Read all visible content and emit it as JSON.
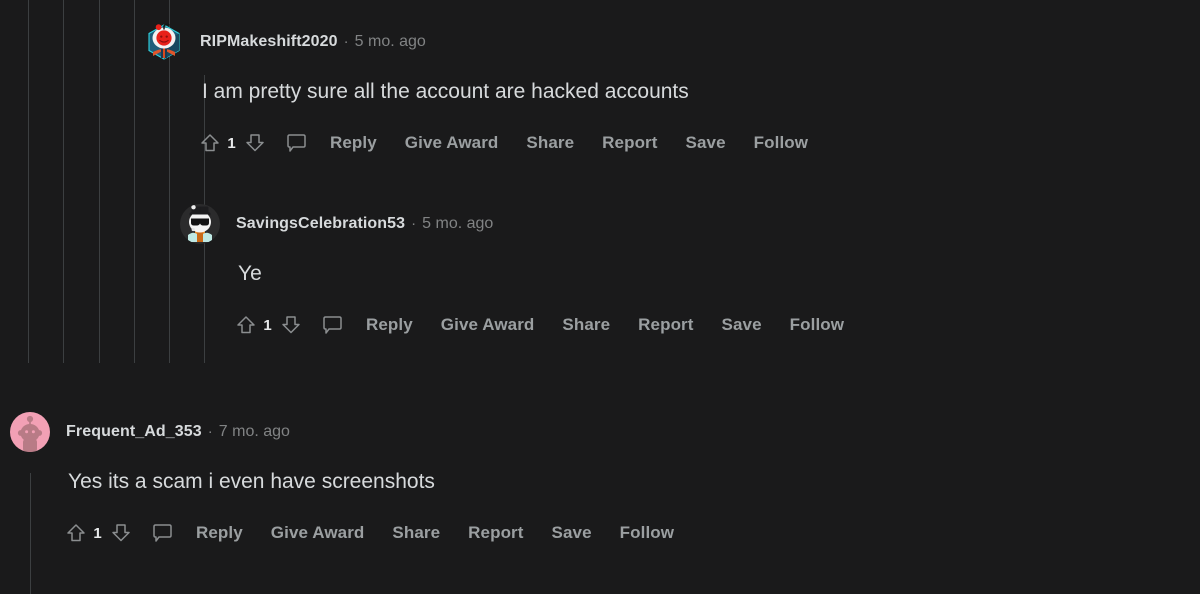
{
  "theme": {
    "background": "#1a1a1b",
    "text_primary": "#d7dadc",
    "text_muted": "#818384",
    "action_text": "#9b9fa1",
    "thread_line": "#3c3f41"
  },
  "actions": {
    "upvote_icon": "upvote-arrow-icon",
    "downvote_icon": "downvote-arrow-icon",
    "comment_icon": "comment-bubble-icon",
    "reply": "Reply",
    "give_award": "Give Award",
    "share": "Share",
    "report": "Report",
    "save": "Save",
    "follow": "Follow"
  },
  "separator": "·",
  "comments": [
    {
      "username": "RIPMakeshift2020",
      "timestamp": "5 mo. ago",
      "body": "I am pretty sure all the account are hacked accounts",
      "score": "1",
      "avatar": "snoo-red-hexagon-avatar"
    },
    {
      "username": "SavingsCelebration53",
      "timestamp": "5 mo. ago",
      "body": "Ye",
      "score": "1",
      "avatar": "snoo-sunglasses-hat-avatar"
    },
    {
      "username": "Frequent_Ad_353",
      "timestamp": "7 mo. ago",
      "body": "Yes its a scam i even have screenshots",
      "score": "1",
      "avatar": "snoo-pink-circle-avatar"
    }
  ]
}
